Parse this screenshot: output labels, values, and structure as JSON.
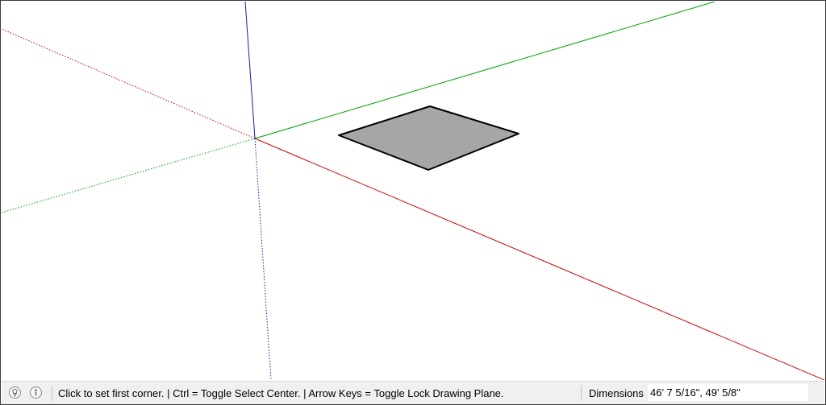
{
  "canvas": {
    "axes": {
      "red_color": "#cc0000",
      "green_color": "#00a000",
      "blue_color": "#1a1aaa"
    },
    "rectangle": {
      "fill": "#a6a6a6",
      "stroke": "#000000"
    }
  },
  "statusbar": {
    "icons": [
      {
        "name": "geolocation-icon"
      },
      {
        "name": "credits-icon"
      }
    ],
    "hint": "Click to set first corner. | Ctrl = Toggle Select Center. | Arrow Keys = Toggle Lock Drawing Plane.",
    "dimensions_label": "Dimensions",
    "dimensions_value": "46' 7 5/16\", 49' 5/8\""
  }
}
